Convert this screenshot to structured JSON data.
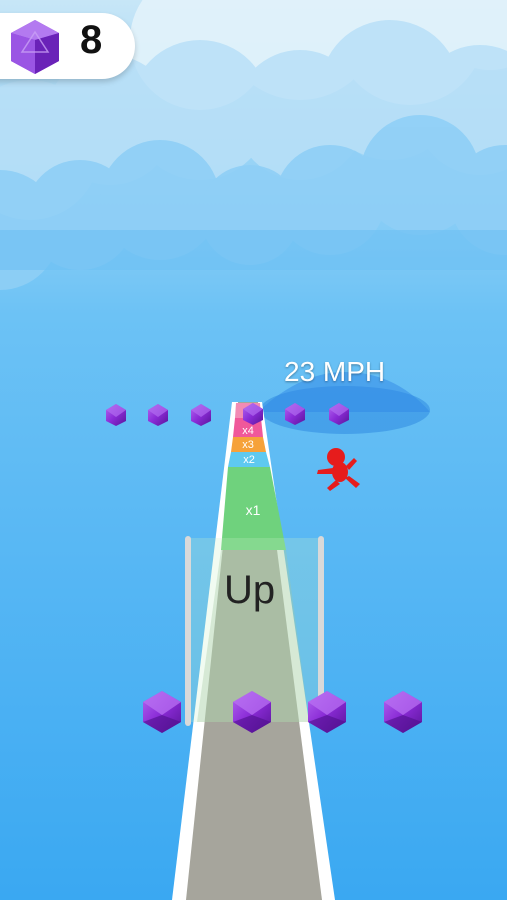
{
  "hud": {
    "gem_count": "8",
    "gem_icon": "gem-icon"
  },
  "speed_indicator": {
    "text": "23 MPH"
  },
  "track": {
    "multipliers": [
      "x4",
      "x3",
      "x2",
      "x1"
    ],
    "gate_label": "Up"
  },
  "colors": {
    "sky_top": "#d6ecf8",
    "sky_bottom": "#3aa8f2",
    "gem": "#8a2bd6",
    "player": "#e61c1c",
    "track_surface": "#a6a59c",
    "track_edge": "#ffffff"
  }
}
